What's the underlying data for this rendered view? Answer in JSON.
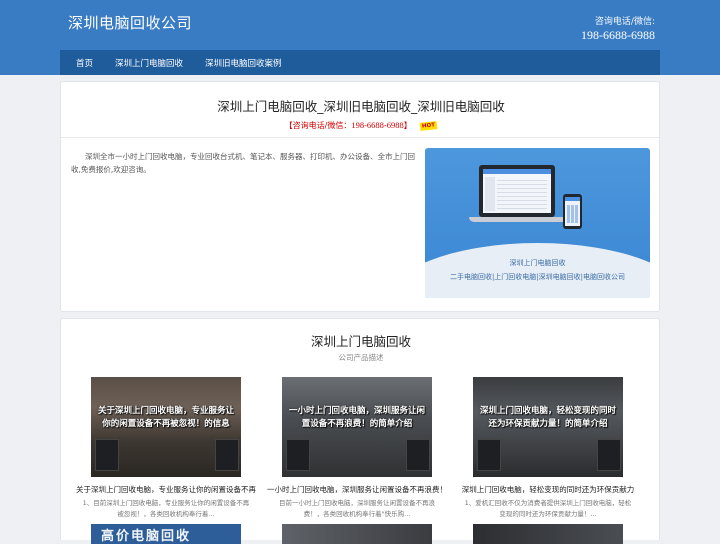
{
  "header": {
    "brand": "深圳电脑回收公司",
    "contact_label": "咨询电话/微信:",
    "contact_phone": "198-6688-6988"
  },
  "nav": {
    "items": [
      {
        "label": "首页"
      },
      {
        "label": "深圳上门电脑回收"
      },
      {
        "label": "深圳旧电脑回收案例"
      }
    ]
  },
  "hero": {
    "title": "深圳上门电脑回收_深圳旧电脑回收_深圳旧电脑回收",
    "hotline_prefix": "【咨询电话/微信：",
    "hotline_number": "198-6688-6988",
    "hotline_suffix": "】",
    "hot_badge": "HOT",
    "intro": "深圳全市一小时上门回收电脑，专业回收台式机、笔记本、服务器、打印机、办公设备、全市上门回收,免费报价,欢迎咨询。",
    "banner_line1": "深圳上门电脑回收",
    "banner_line2": "二手电脑回收|上门回收电脑|深圳电脑回收|电脑回收公司"
  },
  "products": {
    "title": "深圳上门电脑回收",
    "subtitle": "公司产品描述",
    "items": [
      {
        "overlay": "关于深圳上门回收电脑，专业服务让你的闲置设备不再被忽视！的信息",
        "title": "关于深圳上门回收电脑，专业服务让你的闲置设备不再",
        "desc": "1、目前深圳上门回收电脑，专业服务让你的闲置设备不再被忽视！，各类回收机构奉行着..."
      },
      {
        "overlay": "一小时上门回收电脑，深圳服务让闲置设备不再浪费！的简单介绍",
        "title": "一小时上门回收电脑，深圳服务让闲置设备不再浪费！",
        "desc": "目前一小时上门回收电脑，深圳服务让闲置设备不再浪费！，各类回收机构奉行着\"快乐购..."
      },
      {
        "overlay": "深圳上门回收电脑，轻松变现的同时还为环保贡献力量！的简单介绍",
        "title": "深圳上门回收电脑，轻松变现的同时还为环保贡献力",
        "desc": "1、爱机汇回收不仅为消费者提供深圳上门回收电脑，轻松变现的同时还为环保贡献力量！..."
      }
    ],
    "peek_text": "高价电脑回收"
  },
  "colors": {
    "header_bg": "#3a7cc4",
    "nav_bg": "#1f5c9c",
    "hotline": "#d10000"
  }
}
